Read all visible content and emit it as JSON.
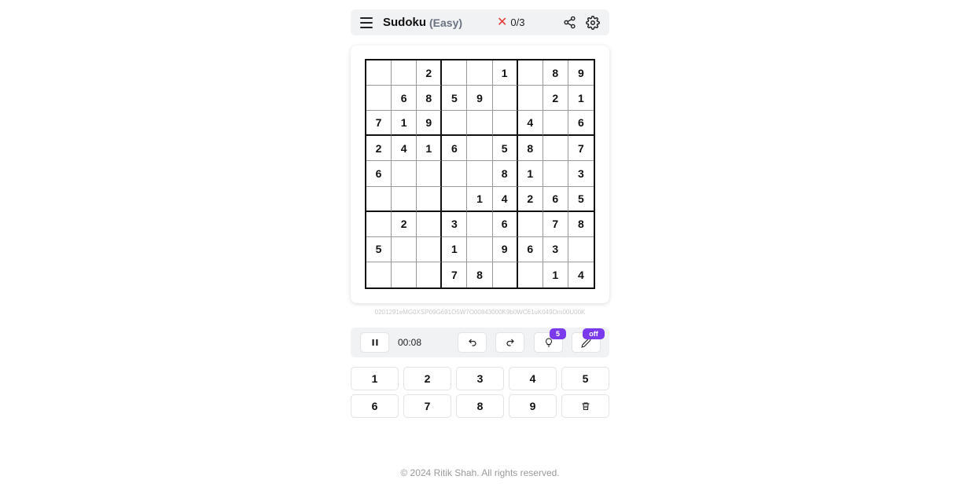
{
  "header": {
    "title": "Sudoku",
    "difficulty": "(Easy)",
    "mistakes_icon": "close-x-icon",
    "mistakes": "0/3",
    "icons": [
      "menu-icon",
      "share-icon",
      "gear-icon"
    ]
  },
  "board": {
    "rows": [
      [
        "",
        "",
        "2",
        "",
        "",
        "1",
        "",
        "8",
        "9"
      ],
      [
        "",
        "6",
        "8",
        "5",
        "9",
        "",
        "",
        "2",
        "1"
      ],
      [
        "7",
        "1",
        "9",
        "",
        "",
        "",
        "4",
        "",
        "6"
      ],
      [
        "2",
        "4",
        "1",
        "6",
        "",
        "5",
        "8",
        "",
        "7"
      ],
      [
        "6",
        "",
        "",
        "",
        "",
        "8",
        "1",
        "",
        "3"
      ],
      [
        "",
        "",
        "",
        "",
        "1",
        "4",
        "2",
        "6",
        "5"
      ],
      [
        "",
        "2",
        "",
        "3",
        "",
        "6",
        "",
        "7",
        "8"
      ],
      [
        "5",
        "",
        "",
        "1",
        "",
        "9",
        "6",
        "3",
        ""
      ],
      [
        "",
        "",
        "",
        "7",
        "8",
        "",
        "",
        "1",
        "4"
      ]
    ]
  },
  "puzzle_code": "0201291eMG0XSP09G691O5W7O00843000K9b0WC61uK049Om00U00K",
  "controls": {
    "timer": "00:08",
    "hints_remaining": "5",
    "pencil_mode": "off"
  },
  "numpad": {
    "keys": [
      "1",
      "2",
      "3",
      "4",
      "5",
      "6",
      "7",
      "8",
      "9"
    ]
  },
  "footer": {
    "copyright": "© 2024 Ritik Shah. All rights reserved."
  },
  "colors": {
    "accent": "#7c3aed",
    "error": "#e53935",
    "panel": "#f1f2f4"
  }
}
